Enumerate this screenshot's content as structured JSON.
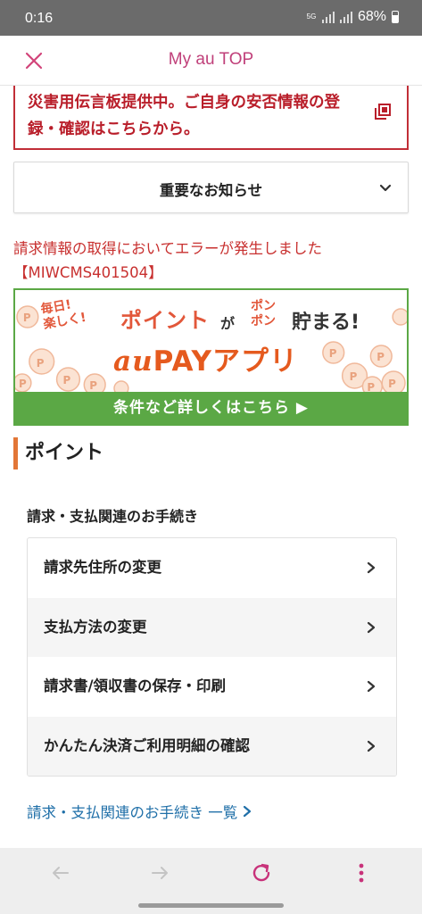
{
  "status_bar": {
    "time": "0:16",
    "network": "5G",
    "battery": "68%"
  },
  "header": {
    "title": "My au TOP",
    "close_icon": "close-icon"
  },
  "alert": {
    "text": "災害用伝言板提供中。ご自身の安否情報の登録・確認はこちらから。",
    "icon": "external-link-icon",
    "color": "#c12e37"
  },
  "notice": {
    "label": "重要なお知らせ",
    "icon": "chevron-down-icon"
  },
  "error": {
    "line1": "請求情報の取得においてエラーが発生しました",
    "line2": "【MIWCMS401504】"
  },
  "banner": {
    "badge_line1": "毎日!",
    "badge_line2": "楽しく!",
    "catch1": "ポイント",
    "catch2": "が",
    "catch3_line1": "ポン",
    "catch3_line2": "ポン",
    "catch4": "貯まる!",
    "brand_au": "au",
    "brand_rest": "PAYアプリ",
    "cta": "条件など詳しくはこちら ▶",
    "accent": "#5ba845"
  },
  "points_section": {
    "heading": "ポイント",
    "accent": "#e27637"
  },
  "billing": {
    "title": "請求・支払関連のお手続き",
    "items": [
      {
        "label": "請求先住所の変更"
      },
      {
        "label": "支払方法の変更"
      },
      {
        "label": "請求書/領収書の保存・印刷"
      },
      {
        "label": "かんたん決済ご利用明細の確認"
      }
    ],
    "all_link": "請求・支払関連のお手続き 一覧"
  },
  "browser": {
    "icons": [
      "back-arrow-icon",
      "forward-arrow-icon",
      "reload-icon",
      "more-vertical-icon"
    ]
  }
}
